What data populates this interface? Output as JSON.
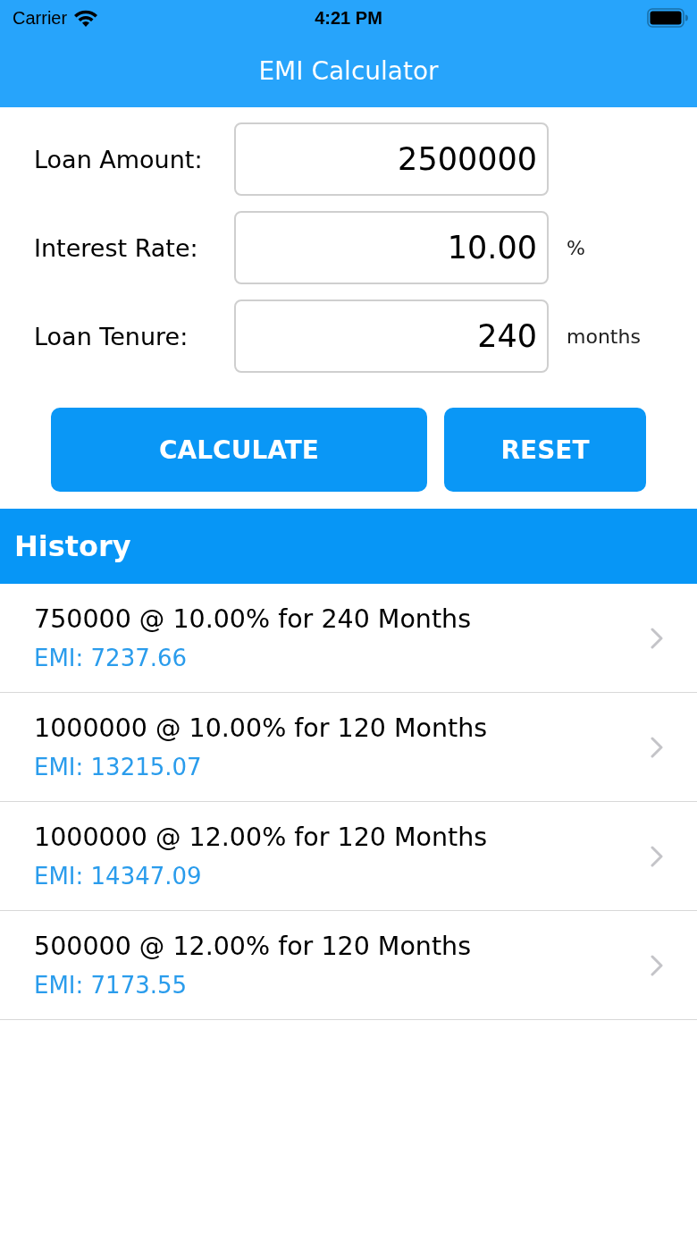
{
  "status_bar": {
    "carrier": "Carrier",
    "time": "4:21 PM"
  },
  "nav_bar": {
    "title": "EMI Calculator"
  },
  "form": {
    "fields": [
      {
        "label": "Loan Amount:",
        "value": "2500000"
      },
      {
        "label": "Interest Rate:",
        "value": "10.00",
        "unit": "%"
      },
      {
        "label": "Loan Tenure:",
        "value": "240",
        "unit": "months"
      }
    ]
  },
  "buttons": [
    {
      "label": "CALCULATE"
    },
    {
      "label": "RESET"
    }
  ],
  "history": {
    "title": "History",
    "rows": [
      {
        "title": "750000 @ 10.00% for 240 Months",
        "emi": "EMI: 7237.66"
      },
      {
        "title": "1000000 @ 10.00% for 120 Months",
        "emi": "EMI: 13215.07"
      },
      {
        "title": "1000000 @ 12.00% for 120 Months",
        "emi": "EMI: 14347.09"
      },
      {
        "title": "500000 @ 12.00% for 120 Months",
        "emi": "EMI: 7173.55"
      }
    ]
  }
}
